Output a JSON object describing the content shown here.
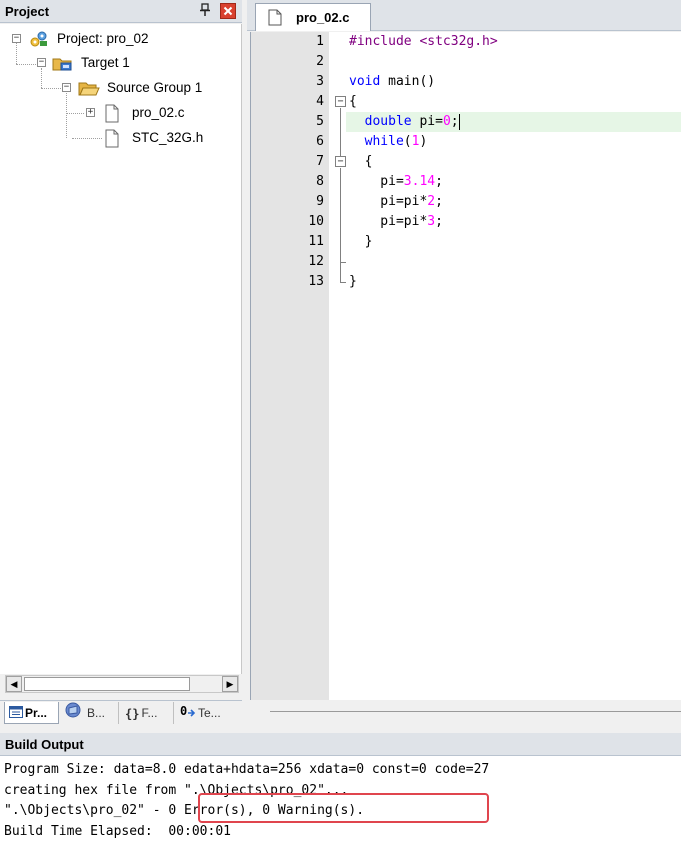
{
  "project_panel": {
    "title": "Project",
    "pin_glyph": "ф",
    "close_glyph": "x",
    "tree": {
      "project": "Project: pro_02",
      "target": "Target 1",
      "group": "Source Group 1",
      "files": [
        "pro_02.c",
        "STC_32G.h"
      ]
    },
    "bottom_tabs": [
      {
        "label": "Pr...",
        "icon": "project-tab-icon"
      },
      {
        "label": "B...",
        "icon": "books-tab-icon"
      },
      {
        "label": "F...",
        "icon": "functions-tab-icon"
      },
      {
        "label": "Te...",
        "icon": "templates-tab-icon"
      }
    ]
  },
  "editor": {
    "tab_label": "pro_02.c",
    "line_numbers": [
      "1",
      "2",
      "3",
      "4",
      "5",
      "6",
      "7",
      "8",
      "9",
      "10",
      "11",
      "12",
      "13"
    ],
    "lines": [
      "#include <stc32g.h>",
      "",
      "void main()",
      "{",
      "  double pi=0;",
      "  while(1)",
      "  {",
      "    pi=3.14;",
      "    pi=pi*2;",
      "    pi=pi*3;",
      "  }",
      "",
      "}"
    ],
    "current_line": 5
  },
  "build_output": {
    "title": "Build Output",
    "lines": [
      "Program Size: data=8.0 edata+hdata=256 xdata=0 const=0 code=27",
      "creating hex file from \".\\Objects\\pro_02\"...",
      "\".\\Objects\\pro_02\" - 0 Error(s), 0 Warning(s).",
      "Build Time Elapsed:  00:00:01"
    ],
    "highlight_color": "#e0454e"
  }
}
